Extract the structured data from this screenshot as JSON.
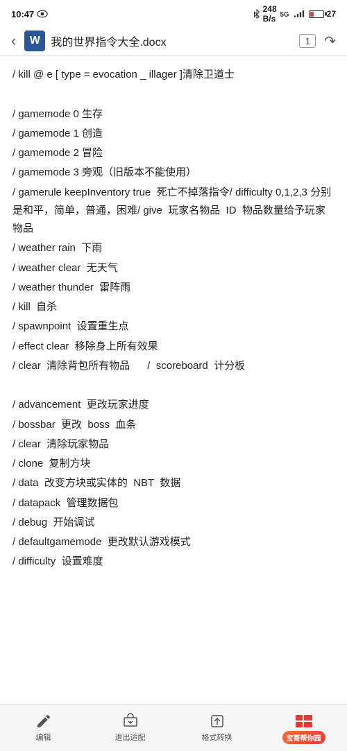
{
  "statusBar": {
    "time": "10:47",
    "bluetooth": "蓝牙",
    "data": "248 B/s",
    "signal": "5G",
    "battery": "27"
  },
  "toolbar": {
    "wordIcon": "W",
    "title": "我的世界指令大全.docx",
    "page": "1",
    "backIcon": "back",
    "shareIcon": "share"
  },
  "content": {
    "lines": [
      "/ kill @ e [ type = evocation _ illager ]清除卫道士",
      "",
      "/ gamemode 0 生存",
      "/ gamemode 1 创造",
      "/ gamemode 2 冒险",
      "/ gamemode 3 旁观（旧版本不能使用）",
      "/ gamerule keepInventory true  死亡不掉落指令/ difficulty 0,1,2,3 分别是和平，简单，普通，困难/ give  玩家名物品  ID  物品数量给予玩家物品",
      "/ weather rain  下雨",
      "/ weather clear  无天气",
      "/ weather thunder  雷阵雨",
      "/ kill  自杀",
      "/ spawnpoint  设置重生点",
      "/ effect clear  移除身上所有效果",
      "/ clear  清除背包所有物品       /  scoreboard  计分板",
      "",
      "/ advancement  更改玩家进度",
      "/ bossbar  更改  boss  血条",
      "/ clear  清除玩家物品",
      "/ clone  复制方块",
      "/ data  改变方块或实体的  NBT  数据",
      "/ datapack  管理数据包",
      "/ debug  开始调试",
      "/ defaultgamemode  更改默认游戏模式",
      "/ difficulty  设置难度"
    ]
  },
  "bottomNav": {
    "items": [
      {
        "label": "编辑",
        "icon": "edit"
      },
      {
        "label": "退出适配",
        "icon": "exit-adapt"
      },
      {
        "label": "格式转换",
        "icon": "format"
      },
      {
        "label": "宝哥帮你园",
        "icon": "baoge",
        "special": true
      }
    ]
  }
}
